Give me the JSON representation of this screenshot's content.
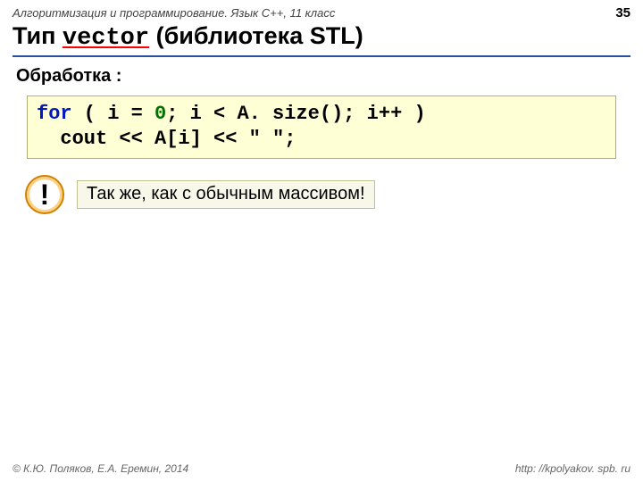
{
  "header": {
    "course": "Алгоритмизация и программирование. Язык C++, 11 класс",
    "page": "35"
  },
  "title": {
    "prefix": "Тип ",
    "mono": "vector",
    "suffix": " (библиотека STL)"
  },
  "subhead": "Обработка :",
  "code": {
    "kw_for": "for",
    "open": " ( i = ",
    "zero": "0",
    "cond": "; i < A. size(); i++ )",
    "line2a": "  cout << A[i] << ",
    "line2q": "\" \"",
    "line2b": ";"
  },
  "callout": {
    "bang": "!",
    "text": "Так же, как с обычным массивом!"
  },
  "footer": {
    "left": "© К.Ю. Поляков, Е.А. Еремин, 2014",
    "right": "http: //kpolyakov. spb. ru"
  }
}
